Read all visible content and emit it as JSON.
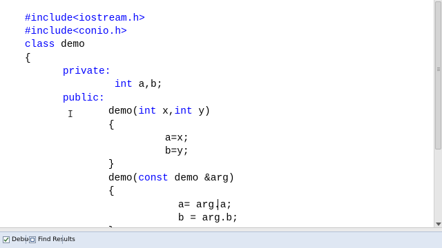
{
  "editor": {
    "lines": [
      {
        "kw": "",
        "text": "#include<iostream.h>"
      },
      {
        "kw": "",
        "text": "#include<conio.h>"
      },
      {
        "kw": "",
        "text": "class demo"
      },
      {
        "kw": "",
        "text": "{"
      },
      {
        "kw": "private:",
        "text": ""
      },
      {
        "kw": "int",
        "text": " a,b;"
      },
      {
        "kw": "public:",
        "text": ""
      },
      {
        "kw": "",
        "text": "demo(int x,int y)"
      },
      {
        "kw": "",
        "text": "{"
      },
      {
        "kw": "",
        "text": "a=x;"
      },
      {
        "kw": "",
        "text": "b=y;"
      },
      {
        "kw": "",
        "text": "}"
      },
      {
        "kw": "",
        "text": "demo(const demo &arg)"
      },
      {
        "kw": "",
        "text": "{"
      },
      {
        "kw": "",
        "text": "a= arg.a;"
      },
      {
        "kw": "",
        "text": "b = arg.b;"
      },
      {
        "kw": "",
        "text": "}"
      }
    ],
    "keyword_color": "#0000ff",
    "text_color": "#000000"
  },
  "bottom_tabs": [
    {
      "label": "Debug",
      "icon": "debug-icon"
    },
    {
      "label": "Find Results",
      "icon": "find-results-icon"
    }
  ]
}
